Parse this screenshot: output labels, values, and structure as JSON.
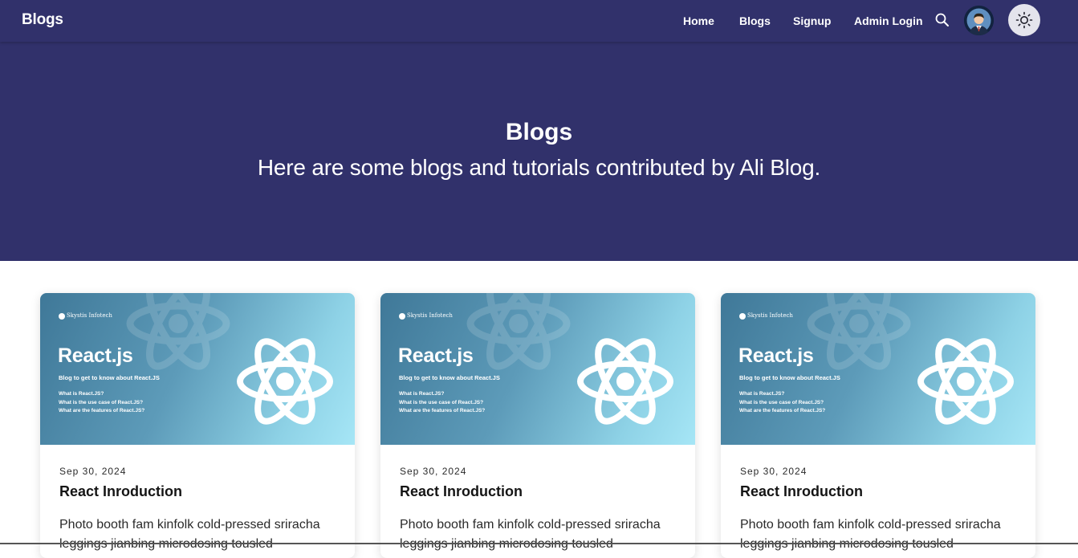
{
  "navbar": {
    "brand": "Blogs",
    "links": [
      "Home",
      "Blogs",
      "Signup",
      "Admin Login"
    ],
    "search_icon": "search-icon",
    "avatar_icon": "user-avatar",
    "theme_icon": "sun-icon"
  },
  "hero": {
    "title": "Blogs",
    "subtitle": "Here are some blogs and tutorials contributed by Ali Blog."
  },
  "colors": {
    "primary": "#31316b",
    "background": "#ffffff"
  },
  "cards": [
    {
      "date": "Sep 30, 2024",
      "title": "React Inroduction",
      "excerpt": "Photo booth fam kinfolk cold-pressed sriracha leggings jianbing microdosing tousled",
      "thumbnail": {
        "brand": "Skystis Infotech",
        "title": "React.js",
        "subtitle": "Blog to get to know about React.JS",
        "questions": [
          "What is React.JS?",
          "What is the use case of React.JS?",
          "What are the features of React.JS?"
        ]
      }
    },
    {
      "date": "Sep 30, 2024",
      "title": "React Inroduction",
      "excerpt": "Photo booth fam kinfolk cold-pressed sriracha leggings jianbing microdosing tousled",
      "thumbnail": {
        "brand": "Skystis Infotech",
        "title": "React.js",
        "subtitle": "Blog to get to know about React.JS",
        "questions": [
          "What is React.JS?",
          "What is the use case of React.JS?",
          "What are the features of React.JS?"
        ]
      }
    },
    {
      "date": "Sep 30, 2024",
      "title": "React Inroduction",
      "excerpt": "Photo booth fam kinfolk cold-pressed sriracha leggings jianbing microdosing tousled",
      "thumbnail": {
        "brand": "Skystis Infotech",
        "title": "React.js",
        "subtitle": "Blog to get to know about React.JS",
        "questions": [
          "What is React.JS?",
          "What is the use case of React.JS?",
          "What are the features of React.JS?"
        ]
      }
    }
  ]
}
